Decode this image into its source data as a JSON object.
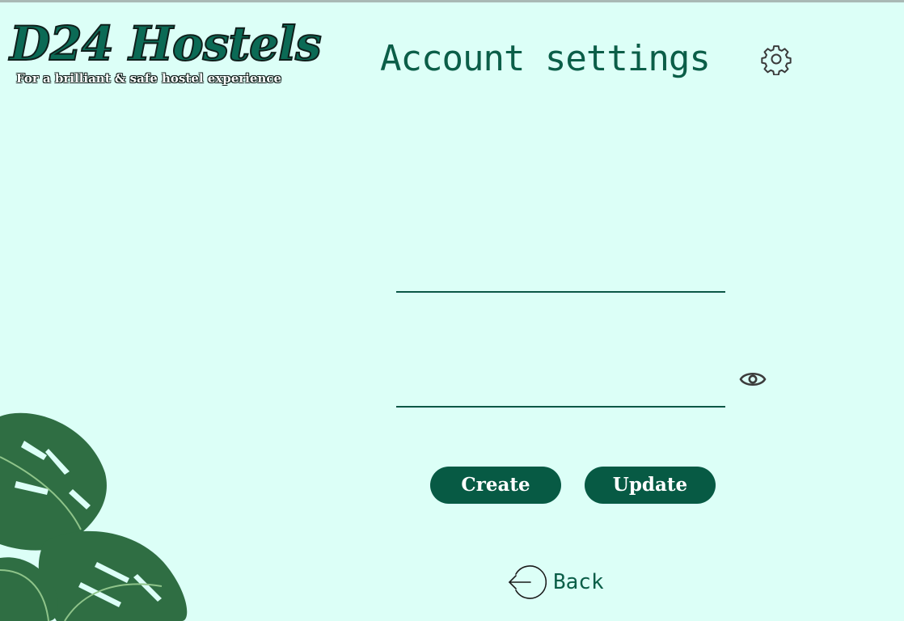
{
  "brand": {
    "name": "D24 Hostels",
    "tagline": "For a brilliant & safe hostel experience",
    "color": "#0b6a55"
  },
  "header": {
    "title": "Account settings",
    "icon": "gear-icon"
  },
  "form": {
    "username": {
      "value": "",
      "placeholder": ""
    },
    "password": {
      "value": "",
      "placeholder": "",
      "toggle_icon": "eye-icon"
    }
  },
  "buttons": {
    "create_label": "Create",
    "update_label": "Update",
    "color": "#075a44"
  },
  "back": {
    "label": "Back",
    "icon": "logout-arrow-icon"
  },
  "colors": {
    "background": "#dcfff7",
    "accent": "#0b5e48"
  }
}
